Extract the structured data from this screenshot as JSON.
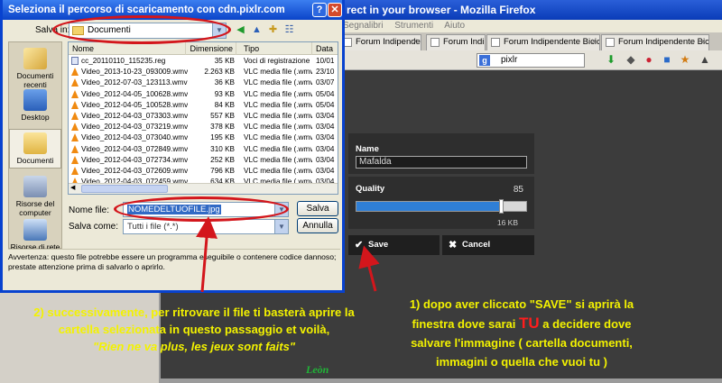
{
  "firefox": {
    "title": "rect in your browser - Mozilla Firefox",
    "menu": [
      "Segnalibri",
      "Strumenti",
      "Aiuto"
    ],
    "tabs": [
      "Forum Indipendente Bicicl...",
      "Forum Indipendente Bicicl...",
      "Forum Indipendente Bicicl...",
      "Forum Indipendente Bicicl..."
    ],
    "search_value": "pixlr",
    "search_engine_icon": "google-icon",
    "toolbar_icons": [
      "download-arrow-icon",
      "addon-icon",
      "addon-icon",
      "addon-icon",
      "addon-icon",
      "addon-icon"
    ]
  },
  "pixlr": {
    "name_label": "Name",
    "name_value": "Mafalda",
    "quality_label": "Quality",
    "quality_value": "85",
    "quality_fraction": 0.85,
    "size_label": "16 KB",
    "save_label": "Save",
    "cancel_label": "Cancel"
  },
  "dialog": {
    "title": "Seleziona il percorso di scaricamento con cdn.pixlr.com",
    "lookin_label": "Salva in:",
    "lookin_value": "Documenti",
    "places": [
      "Documenti recenti",
      "Desktop",
      "Documenti",
      "Risorse del computer",
      "Risorse di rete"
    ],
    "columns": [
      "Nome",
      "Dimensione",
      "Tipo",
      "Data"
    ],
    "files": [
      {
        "name": "cc_20110110_115235.reg",
        "size": "35 KB",
        "type": "Voci di registrazione",
        "date": "10/01",
        "icon": "reg"
      },
      {
        "name": "Video_2013-10-23_093009.wmv",
        "size": "2.263 KB",
        "type": "VLC media file (.wmv)",
        "date": "23/10",
        "icon": "vlc"
      },
      {
        "name": "Video_2012-07-03_123113.wmv",
        "size": "36 KB",
        "type": "VLC media file (.wmv)",
        "date": "03/07",
        "icon": "vlc"
      },
      {
        "name": "Video_2012-04-05_100628.wmv",
        "size": "93 KB",
        "type": "VLC media file (.wmv)",
        "date": "05/04",
        "icon": "vlc"
      },
      {
        "name": "Video_2012-04-05_100528.wmv",
        "size": "84 KB",
        "type": "VLC media file (.wmv)",
        "date": "05/04",
        "icon": "vlc"
      },
      {
        "name": "Video_2012-04-03_073303.wmv",
        "size": "557 KB",
        "type": "VLC media file (.wmv)",
        "date": "03/04",
        "icon": "vlc"
      },
      {
        "name": "Video_2012-04-03_073219.wmv",
        "size": "378 KB",
        "type": "VLC media file (.wmv)",
        "date": "03/04",
        "icon": "vlc"
      },
      {
        "name": "Video_2012-04-03_073040.wmv",
        "size": "195 KB",
        "type": "VLC media file (.wmv)",
        "date": "03/04",
        "icon": "vlc"
      },
      {
        "name": "Video_2012-04-03_072849.wmv",
        "size": "310 KB",
        "type": "VLC media file (.wmv)",
        "date": "03/04",
        "icon": "vlc"
      },
      {
        "name": "Video_2012-04-03_072734.wmv",
        "size": "252 KB",
        "type": "VLC media file (.wmv)",
        "date": "03/04",
        "icon": "vlc"
      },
      {
        "name": "Video_2012-04-03_072609.wmv",
        "size": "796 KB",
        "type": "VLC media file (.wmv)",
        "date": "03/04",
        "icon": "vlc"
      },
      {
        "name": "Video_2012-04-03_072459.wmv",
        "size": "634 KB",
        "type": "VLC media file (.wmv)",
        "date": "03/04",
        "icon": "vlc"
      }
    ],
    "filename_label": "Nome file:",
    "filename_value": "NOMEDELTUOFILE.jpg",
    "filetype_label": "Salva come:",
    "filetype_value": "Tutti i file (*.*)",
    "save_button": "Salva",
    "cancel_button": "Annulla",
    "warning": "Avvertenza: questo file potrebbe essere un programma eseguibile o contenere codice dannoso; prestate attenzione prima di salvarlo o aprirlo."
  },
  "annotations": {
    "left_line1": "2) successivamente, per ritrovare il file ti basterà aprire la",
    "left_line2": "cartella selezionata in questo passaggio et voilà,",
    "left_quote": "\"Rien ne va plus, les jeux sont faits\"",
    "right_line1": "1) dopo aver cliccato \"SAVE\" si aprirà la",
    "right_line2a": "finestra dove sarai ",
    "right_tu": "TU",
    "right_line2b": " a decidere dove",
    "right_line3": "salvare l'immagine ( cartella documenti,",
    "right_line4": "immagini o quella che vuoi tu )",
    "signature": "Leòn",
    "oval_color": "#d3161c",
    "text_color": "#f3f200"
  }
}
